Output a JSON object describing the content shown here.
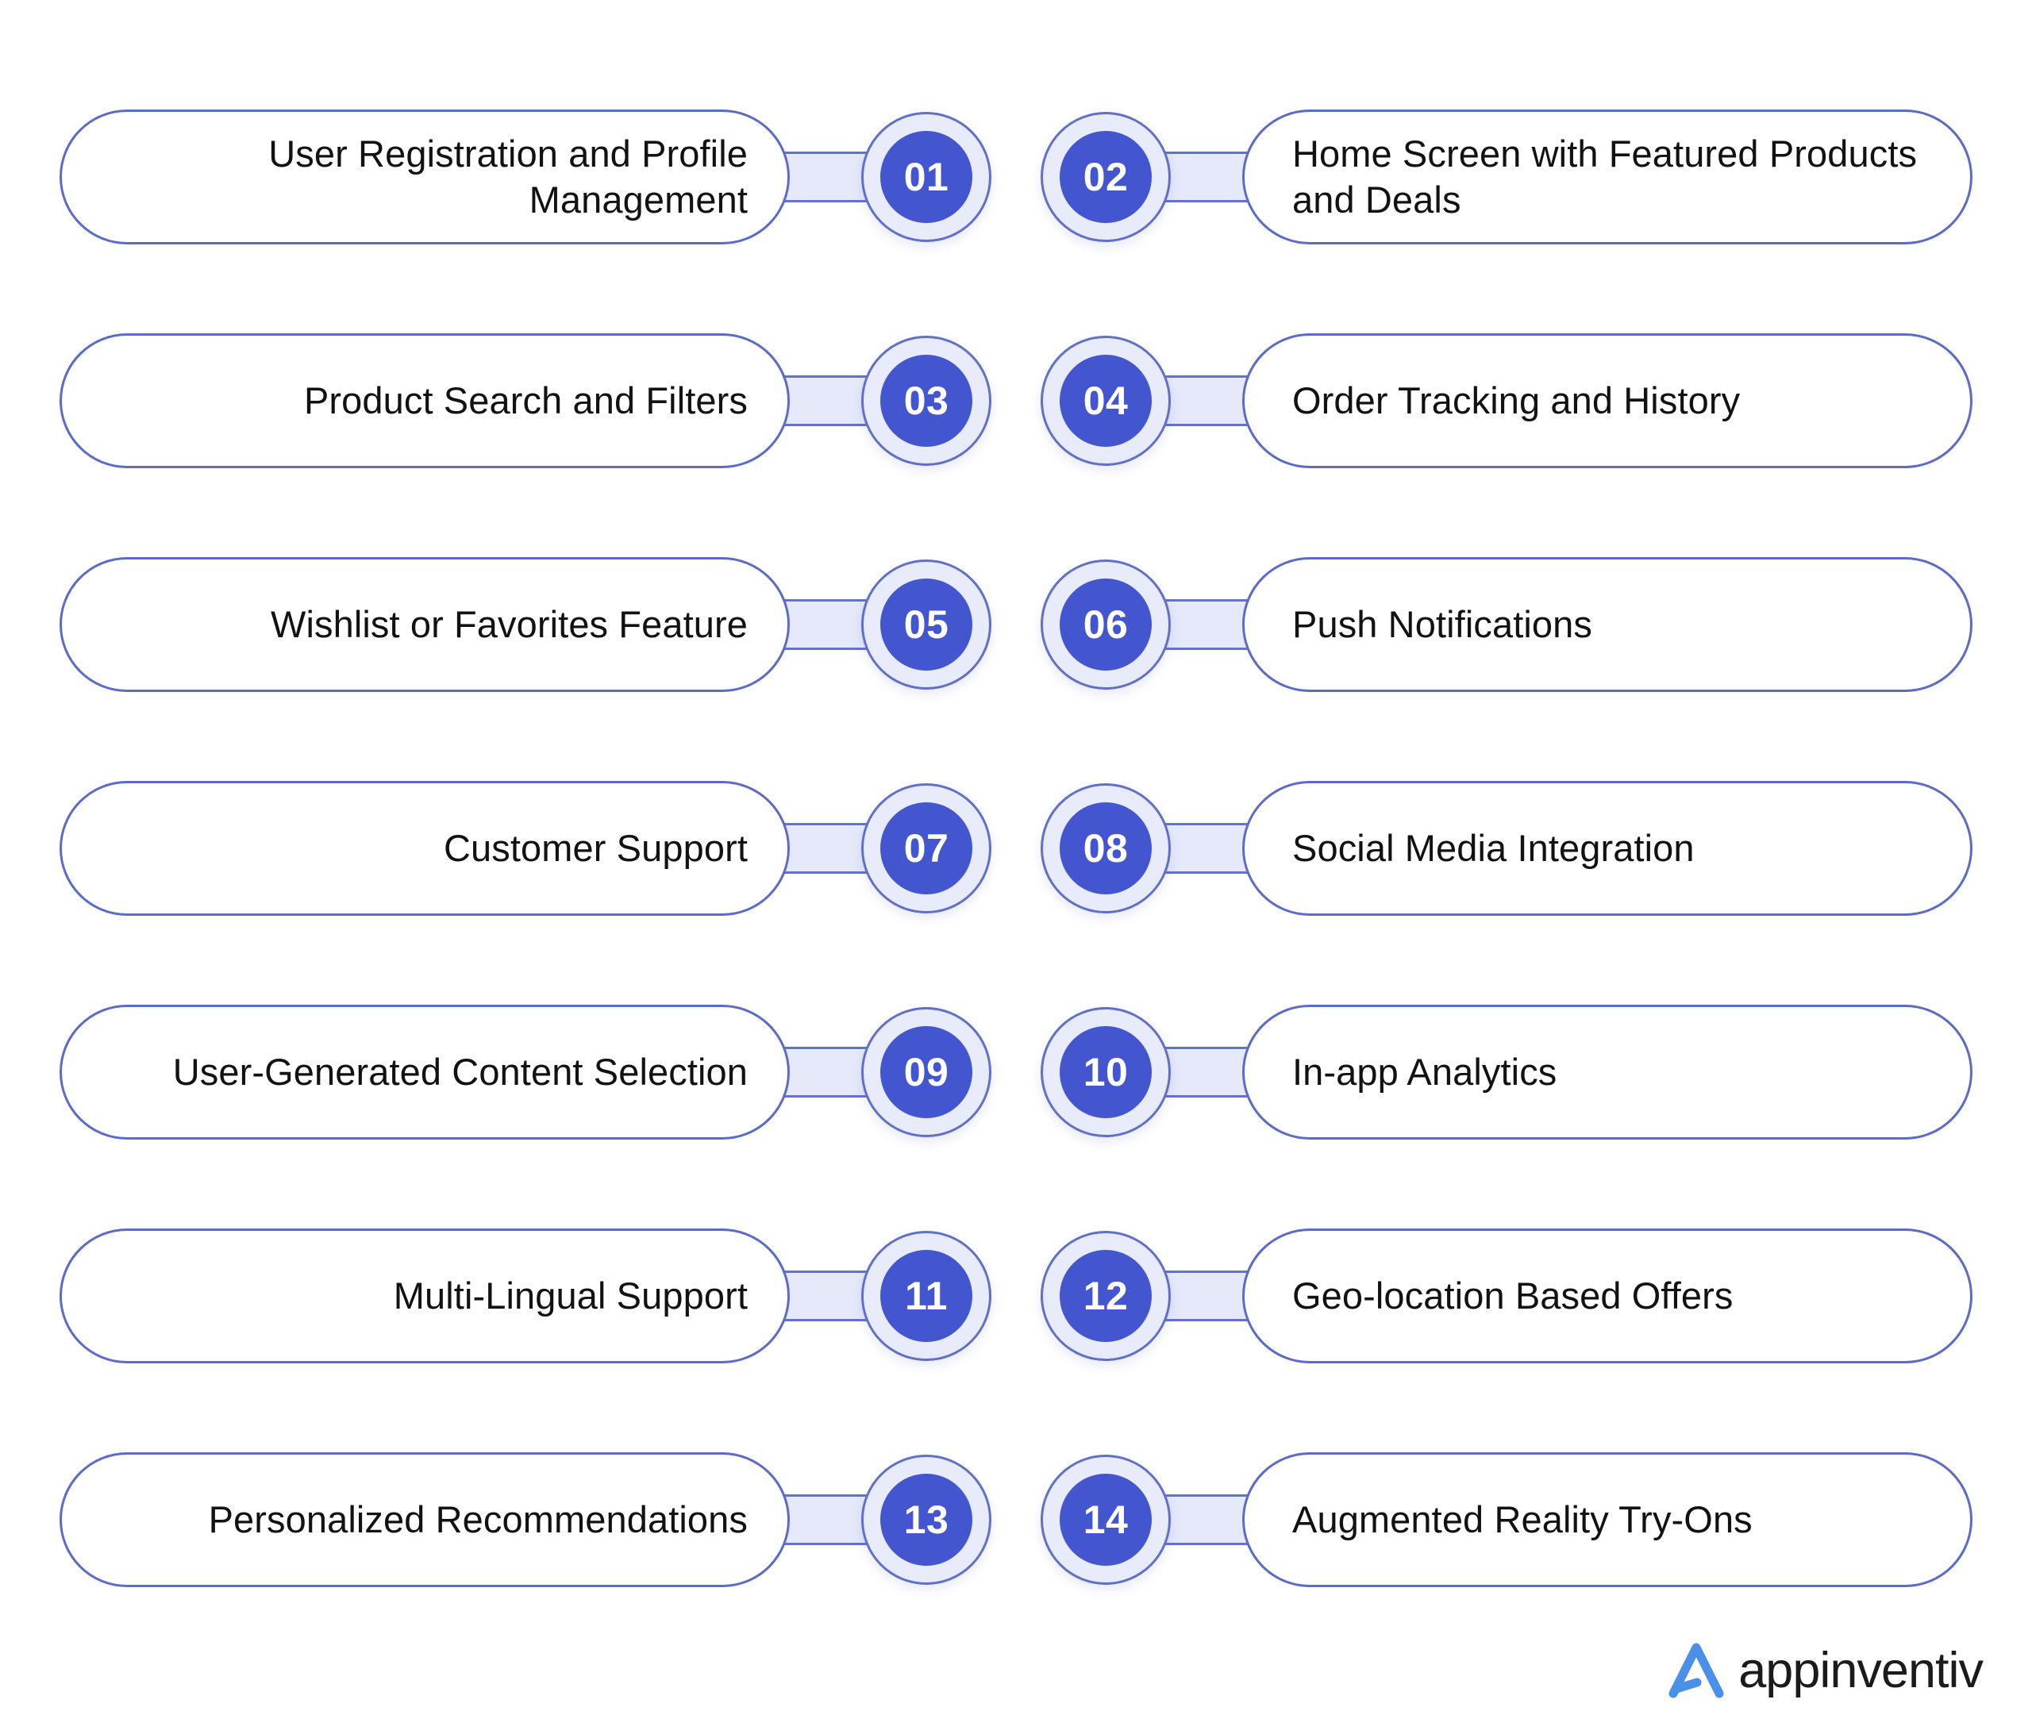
{
  "background_color": "#ffffff",
  "accent_color": "#4356cf",
  "ring_fill_color": "#e8ebfa",
  "border_color": "#5b6bc8",
  "items": [
    {
      "number": "01",
      "label": "User Registration and Profile Management",
      "side": "left"
    },
    {
      "number": "02",
      "label": "Home Screen with Featured Products and Deals",
      "side": "right"
    },
    {
      "number": "03",
      "label": "Product Search and Filters",
      "side": "left"
    },
    {
      "number": "04",
      "label": "Order Tracking and History",
      "side": "right"
    },
    {
      "number": "05",
      "label": "Wishlist or Favorites Feature",
      "side": "left"
    },
    {
      "number": "06",
      "label": "Push Notifications",
      "side": "right"
    },
    {
      "number": "07",
      "label": "Customer Support",
      "side": "left"
    },
    {
      "number": "08",
      "label": "Social Media Integration",
      "side": "right"
    },
    {
      "number": "09",
      "label": "User-Generated Content Selection",
      "side": "left"
    },
    {
      "number": "10",
      "label": "In-app Analytics",
      "side": "right"
    },
    {
      "number": "11",
      "label": "Multi-Lingual Support",
      "side": "left"
    },
    {
      "number": "12",
      "label": "Geo-location Based Offers",
      "side": "right"
    },
    {
      "number": "13",
      "label": "Personalized Recommendations",
      "side": "left"
    },
    {
      "number": "14",
      "label": "Augmented Reality Try-Ons",
      "side": "right"
    }
  ],
  "logo": {
    "text": "appinventiv",
    "mark_color": "#4a90e8",
    "text_color": "#1b1b1d"
  }
}
